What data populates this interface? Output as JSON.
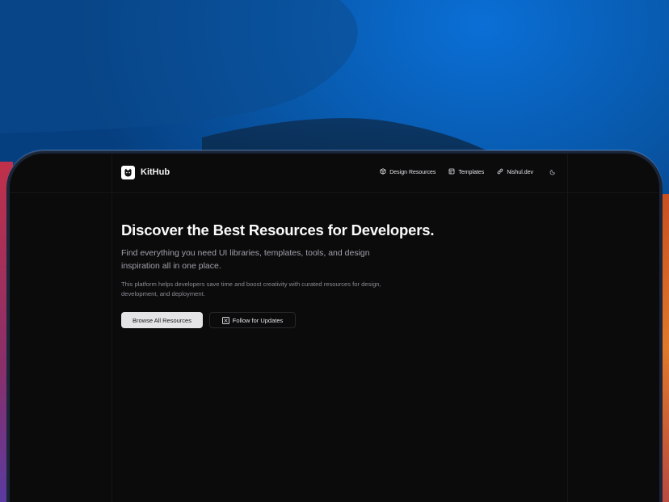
{
  "brand": {
    "name": "KitHub",
    "logo_icon": "cat-icon"
  },
  "nav": {
    "items": [
      {
        "label": "Design Resources",
        "icon": "cube-icon"
      },
      {
        "label": "Templates",
        "icon": "layout-icon"
      },
      {
        "label": "Nishul.dev",
        "icon": "link-icon"
      }
    ],
    "theme_toggle_icon": "moon-icon"
  },
  "hero": {
    "title": "Discover the Best Resources for Developers.",
    "lead": "Find everything you need UI libraries, templates, tools, and design inspiration all in one place.",
    "description": "This platform helps developers save time and boost creativity with curated resources for design, development, and deployment.",
    "primary_button": "Browse All Resources",
    "secondary_button": "Follow for Updates",
    "secondary_button_icon": "x-logo-icon"
  },
  "colors": {
    "screen_bg": "#0b0b0c",
    "text_primary": "#fafafa",
    "text_muted": "#a1a1aa",
    "button_primary_bg": "#e4e4e7",
    "backdrop_blue": "#0a5fb8"
  }
}
